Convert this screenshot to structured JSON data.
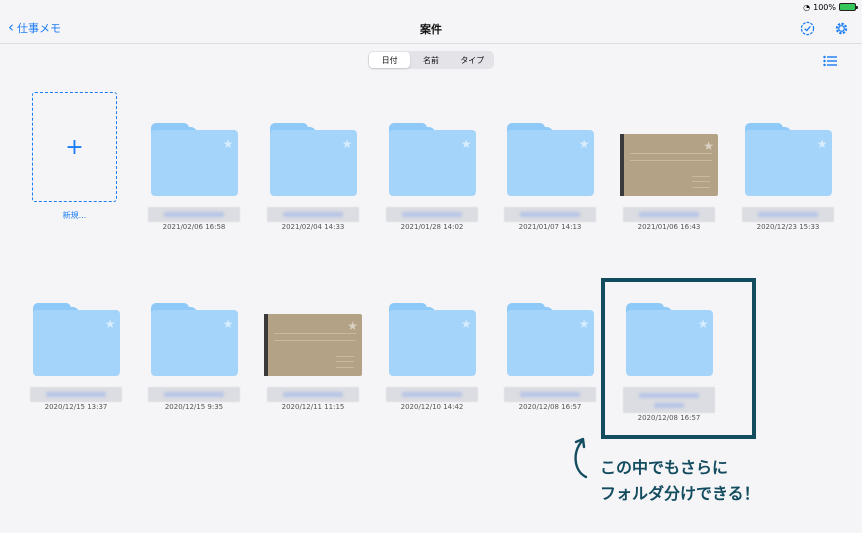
{
  "status": {
    "battery": "100%"
  },
  "nav": {
    "back_label": "仕事メモ",
    "title": "案件"
  },
  "sort": {
    "options": [
      "日付",
      "名前",
      "タイプ"
    ],
    "selected": 0
  },
  "new_item": {
    "label": "新規..."
  },
  "items": [
    {
      "type": "folder",
      "date": "2021/02/06 16:58"
    },
    {
      "type": "folder",
      "date": "2021/02/04 14:33"
    },
    {
      "type": "folder",
      "date": "2021/01/28 14:02"
    },
    {
      "type": "folder",
      "date": "2021/01/07 14:13"
    },
    {
      "type": "notebook",
      "date": "2021/01/06 16:43"
    },
    {
      "type": "folder",
      "date": "2020/12/23 15:33"
    },
    {
      "type": "folder",
      "date": "2020/12/15 13:37"
    },
    {
      "type": "folder",
      "date": "2020/12/15 9:35"
    },
    {
      "type": "notebook",
      "date": "2020/12/11 11:15"
    },
    {
      "type": "folder",
      "date": "2020/12/10 14:42"
    },
    {
      "type": "folder",
      "date": "2020/12/08 16:57"
    },
    {
      "type": "folder",
      "date": "2020/12/08 16:57"
    }
  ],
  "callout": {
    "line1": "この中でもさらに",
    "line2": "フォルダ分けできる！"
  },
  "colors": {
    "accent": "#1a7cf5",
    "folder": "#a5d4fa",
    "highlight": "#134b5f"
  }
}
